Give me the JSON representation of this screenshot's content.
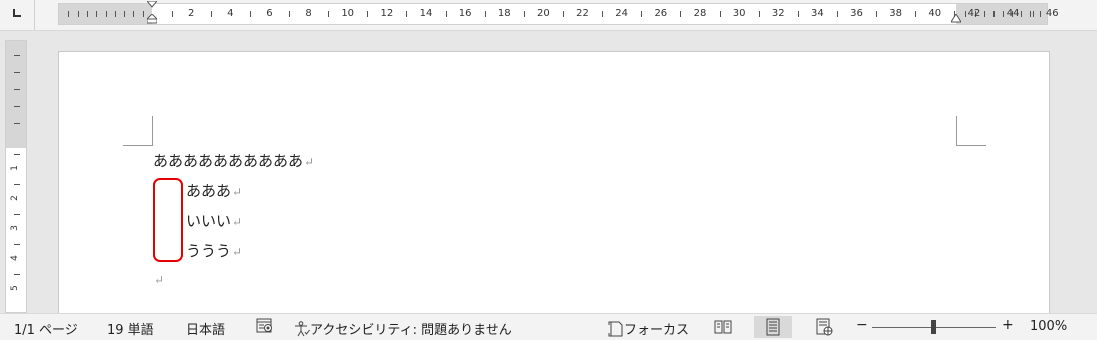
{
  "ruler": {
    "labels": [
      "2",
      "4",
      "6",
      "8",
      "10",
      "12",
      "14",
      "16",
      "18",
      "20",
      "22",
      "24",
      "26",
      "28",
      "30",
      "32",
      "34",
      "36",
      "38",
      "40",
      "42",
      "44",
      "46"
    ],
    "vertical_labels": [
      "1",
      "2",
      "3",
      "4",
      "5"
    ]
  },
  "document": {
    "lines": [
      {
        "text": "ああああああああああ",
        "mark": "↵"
      },
      {
        "text": "あああ",
        "mark": "↵"
      },
      {
        "text": "いいい",
        "mark": "↵"
      },
      {
        "text": "ううう",
        "mark": "↵"
      },
      {
        "text": "",
        "mark": "↵"
      }
    ],
    "highlight_color": "#e60000"
  },
  "status": {
    "page": "1/1 ページ",
    "words": "19 単語",
    "language": "日本語",
    "accessibility": "アクセシビリティ: 問題ありません",
    "focus": "フォーカス",
    "zoom_minus": "−",
    "zoom_plus": "+",
    "zoom_level": "100%",
    "zoom_value_percent": 100
  },
  "icons": {
    "tab_selector": "tab-selector-icon",
    "macro": "macro-record-icon",
    "accessibility": "accessibility-icon",
    "focus": "focus-icon",
    "read_mode": "read-mode-icon",
    "print_layout": "print-layout-icon",
    "web_layout": "web-layout-icon"
  }
}
